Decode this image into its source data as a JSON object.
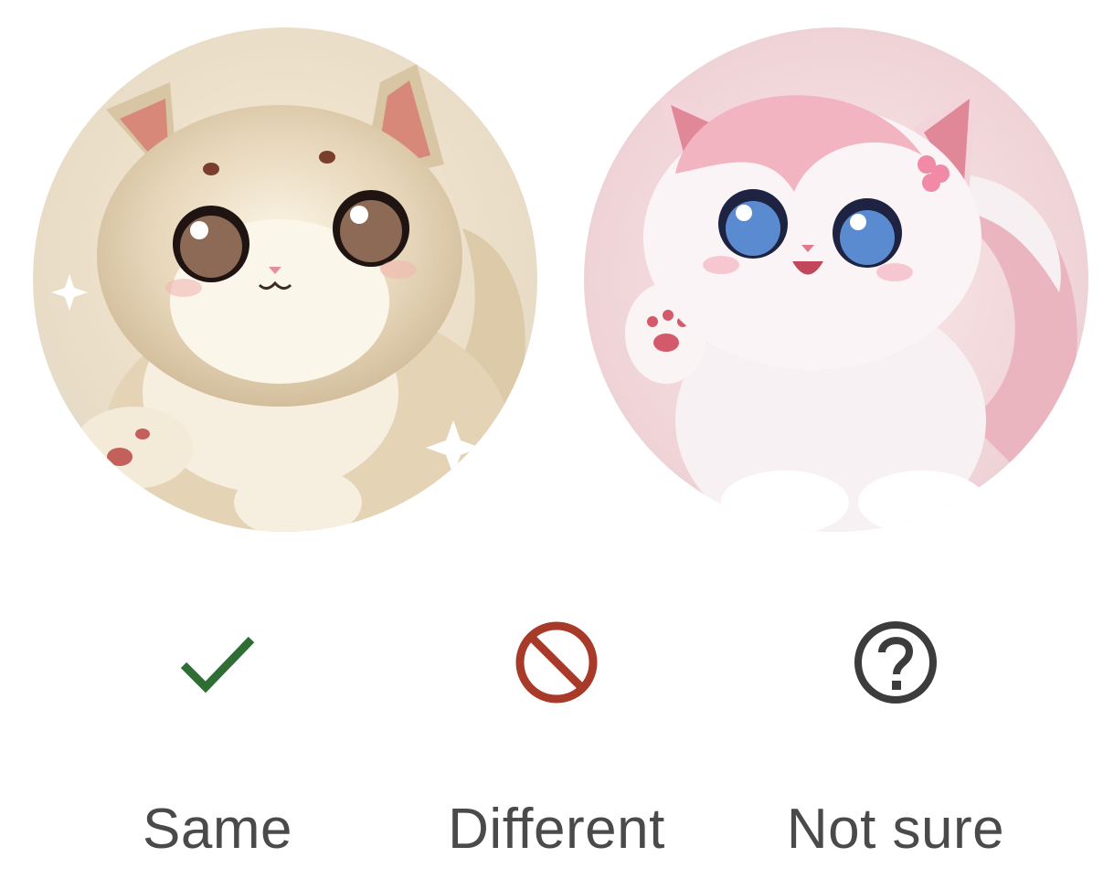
{
  "images": {
    "left": {
      "icon": "fluffy-beige-kitten-illustration"
    },
    "right": {
      "icon": "fluffy-pink-kitten-illustration"
    }
  },
  "choices": [
    {
      "label": "Same",
      "icon": "check-icon",
      "color": "#2e6e35"
    },
    {
      "label": "Different",
      "icon": "prohibited-icon",
      "color": "#a83a2a"
    },
    {
      "label": "Not sure",
      "icon": "question-circle-icon",
      "color": "#3c3c3c"
    }
  ]
}
